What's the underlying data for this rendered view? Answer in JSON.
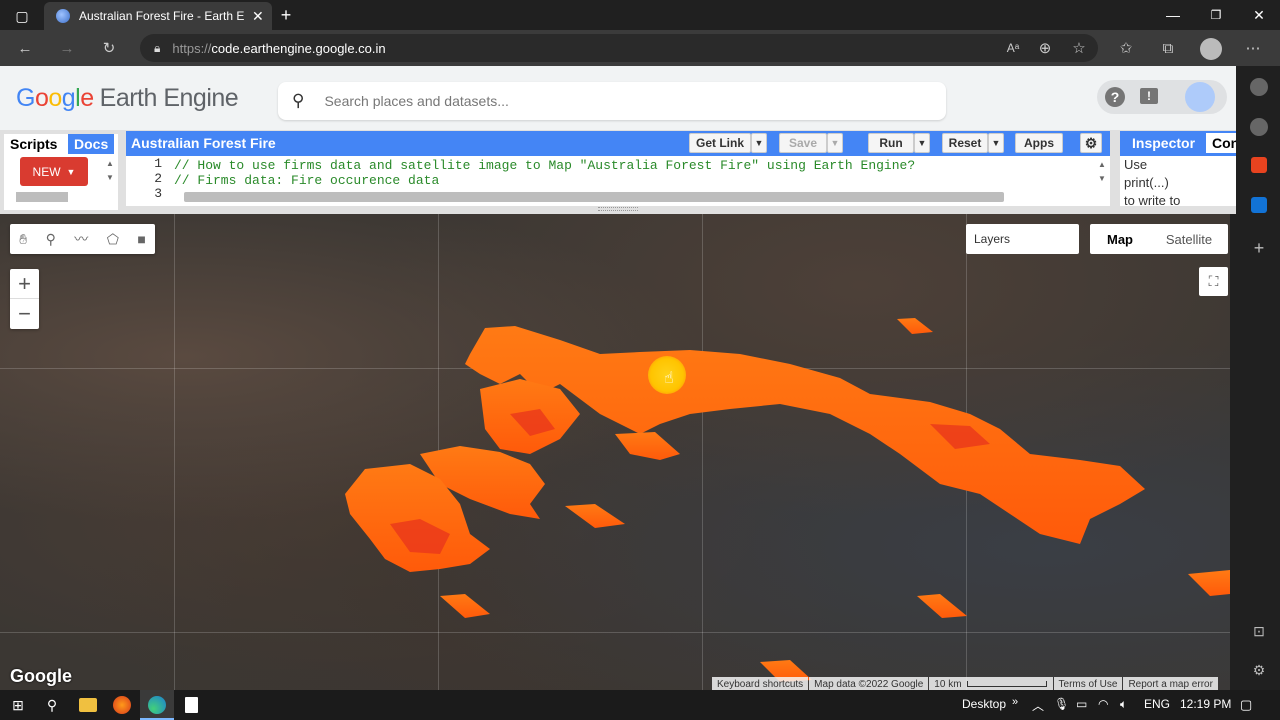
{
  "browser": {
    "tab_title": "Australian Forest Fire - Earth Eng",
    "url_protocol": "https://",
    "url_host": "code.earthengine.google.co.in"
  },
  "gee": {
    "logo_google": [
      "G",
      "o",
      "o",
      "g",
      "l",
      "e"
    ],
    "logo_product": "Earth Engine",
    "search_placeholder": "Search places and datasets..."
  },
  "left_panel": {
    "tabs": [
      "Scripts",
      "Docs"
    ],
    "new_button": "NEW"
  },
  "editor": {
    "script_title": "Australian Forest Fire",
    "buttons": {
      "get_link": "Get Link",
      "save": "Save",
      "run": "Run",
      "reset": "Reset",
      "apps": "Apps"
    },
    "line_numbers": [
      "1",
      "2",
      "3"
    ],
    "lines": [
      "// How to use firms data and satellite image to Map \"Australia Forest Fire\" using Earth Engine?",
      "// Firms data: Fire occurence data",
      ""
    ]
  },
  "right_panel": {
    "tabs": [
      "Inspector",
      "Con"
    ],
    "body_lines": [
      "Use",
      "print(...)",
      "to write to"
    ]
  },
  "map": {
    "layers_label": "Layers",
    "map_type": [
      "Map",
      "Satellite"
    ],
    "zoom_in": "+",
    "zoom_out": "−",
    "logo": "Google",
    "attribution": {
      "shortcuts": "Keyboard shortcuts",
      "map_data": "Map data ©2022 Google",
      "scale": "10 km",
      "terms": "Terms of Use",
      "report": "Report a map error"
    },
    "fire_color": "#ff6a10"
  },
  "taskbar": {
    "desktop_label": "Desktop",
    "language": "ENG",
    "time": "12:19 PM"
  }
}
